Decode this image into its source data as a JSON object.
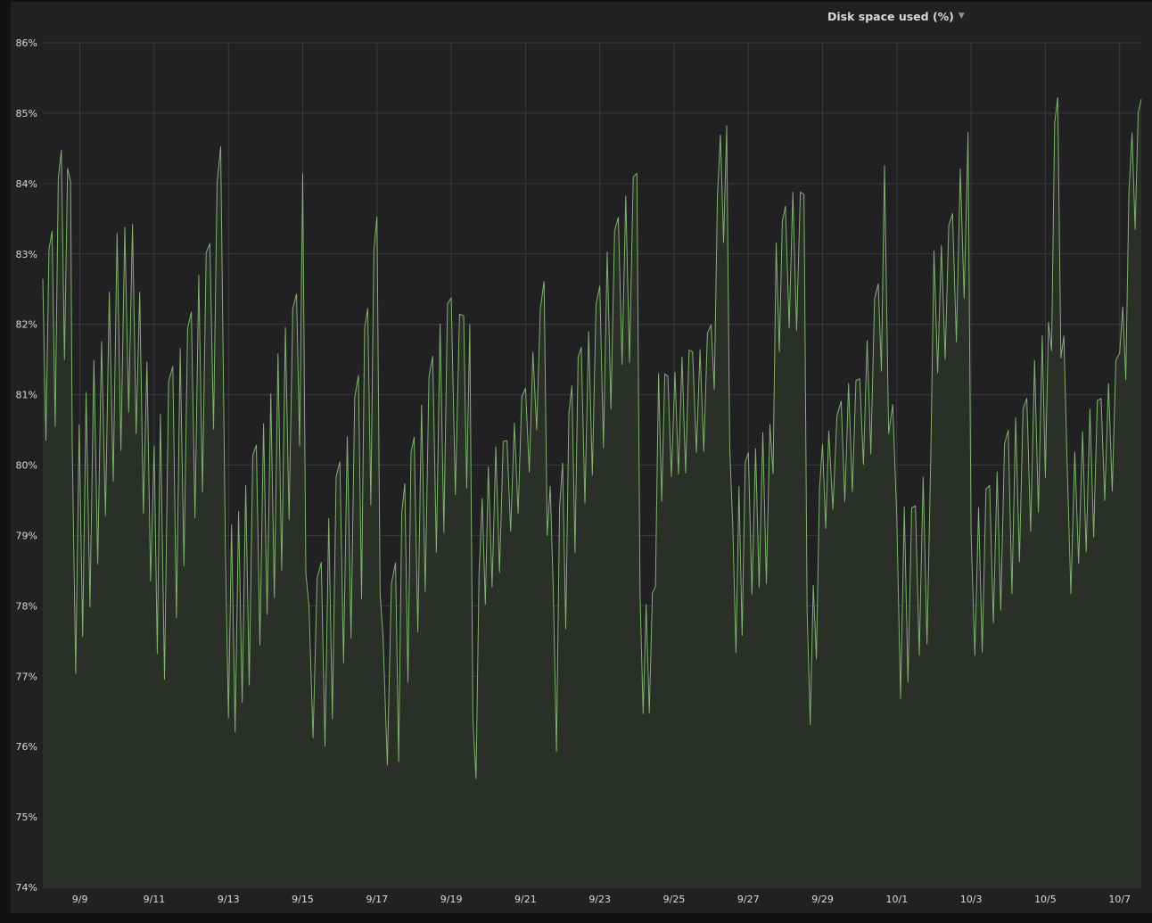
{
  "panel": {
    "title": "Disk space used (%)",
    "menu_icon": "caret-down-icon"
  },
  "colors": {
    "background": "#212124",
    "grid": "#3a3a3d",
    "series_line": "#7eb26d",
    "series_fill": "#2b3129",
    "text": "#d8d9da"
  },
  "chart_data": {
    "type": "area",
    "title": "Disk space used (%)",
    "xlabel": "",
    "ylabel": "",
    "ylim": [
      74,
      86
    ],
    "y_ticks": [
      74,
      75,
      76,
      77,
      78,
      79,
      80,
      81,
      82,
      83,
      84,
      85,
      86
    ],
    "y_tick_labels": [
      "74%",
      "75%",
      "76%",
      "77%",
      "78%",
      "79%",
      "80%",
      "81%",
      "82%",
      "83%",
      "84%",
      "85%",
      "86%"
    ],
    "x_range": [
      "2023-09-08T00:00",
      "2023-10-07T14:00"
    ],
    "x_ticks": [
      "2023-09-09",
      "2023-09-11",
      "2023-09-13",
      "2023-09-15",
      "2023-09-17",
      "2023-09-19",
      "2023-09-21",
      "2023-09-23",
      "2023-09-25",
      "2023-09-27",
      "2023-09-29",
      "2023-10-01",
      "2023-10-03",
      "2023-10-05",
      "2023-10-07"
    ],
    "x_tick_labels": [
      "9/9",
      "9/11",
      "9/13",
      "9/15",
      "9/17",
      "9/19",
      "9/21",
      "9/23",
      "9/25",
      "9/27",
      "9/29",
      "10/1",
      "10/3",
      "10/5",
      "10/7"
    ],
    "grid": true,
    "legend": "none",
    "series": [
      {
        "x": [
          "2023-09-08T00:00",
          "2023-09-08T06:00",
          "2023-09-08T12:00",
          "2023-09-08T18:00",
          "2023-09-08T19:00",
          "2023-09-09T04:00",
          "2023-09-09T14:00",
          "2023-09-10T00:00",
          "2023-09-10T10:00",
          "2023-09-11T00:00",
          "2023-09-11T04:00",
          "2023-09-11T12:00",
          "2023-09-12T00:00",
          "2023-09-12T12:00",
          "2023-09-12T19:00",
          "2023-09-12T22:00",
          "2023-09-13T02:00",
          "2023-09-13T18:00",
          "2023-09-14T08:00",
          "2023-09-14T20:00",
          "2023-09-15T00:00",
          "2023-09-15T04:00",
          "2023-09-15T12:00",
          "2023-09-16T00:00",
          "2023-09-16T12:00",
          "2023-09-16T18:00",
          "2023-09-17T00:00",
          "2023-09-17T04:00",
          "2023-09-17T12:00",
          "2023-09-17T18:00",
          "2023-09-18T00:00",
          "2023-09-18T12:00",
          "2023-09-19T00:00",
          "2023-09-19T08:00",
          "2023-09-19T12:00",
          "2023-09-19T14:00",
          "2023-09-19T20:00",
          "2023-09-20T00:00",
          "2023-09-20T12:00",
          "2023-09-21T00:00",
          "2023-09-21T12:00",
          "2023-09-21T18:00",
          "2023-09-22T00:00",
          "2023-09-22T06:00",
          "2023-09-22T12:00",
          "2023-09-23T00:00",
          "2023-09-23T12:00",
          "2023-09-24T00:00",
          "2023-09-24T02:00",
          "2023-09-24T06:00",
          "2023-09-24T12:00",
          "2023-09-24T14:00",
          "2023-09-24T20:00",
          "2023-09-25T12:00",
          "2023-09-26T00:00",
          "2023-09-26T06:00",
          "2023-09-26T10:00",
          "2023-09-26T14:00",
          "2023-09-26T18:00",
          "2023-09-27T00:00",
          "2023-09-27T14:00",
          "2023-09-27T18:00",
          "2023-09-28T00:00",
          "2023-09-28T12:00",
          "2023-09-28T14:00",
          "2023-09-28T18:00",
          "2023-09-29T00:00",
          "2023-09-29T04:00",
          "2023-09-29T12:00",
          "2023-09-30T00:00",
          "2023-09-30T12:00",
          "2023-09-30T16:00",
          "2023-10-01T00:00",
          "2023-10-01T12:00",
          "2023-10-01T22:00",
          "2023-10-02T00:00",
          "2023-10-02T12:00",
          "2023-10-02T22:00",
          "2023-10-03T00:00",
          "2023-10-03T12:00",
          "2023-10-04T00:00",
          "2023-10-04T12:00",
          "2023-10-04T22:00",
          "2023-10-05T02:00",
          "2023-10-05T06:00",
          "2023-10-05T08:00",
          "2023-10-05T14:00",
          "2023-10-06T00:00",
          "2023-10-06T12:00",
          "2023-10-07T00:00",
          "2023-10-07T02:00",
          "2023-10-07T08:00",
          "2023-10-07T14:00"
        ],
        "high": [
          82.7,
          83.5,
          84.5,
          84.1,
          80.4,
          81.1,
          81.9,
          83.3,
          83.6,
          80.4,
          80.9,
          81.4,
          82.3,
          83.3,
          84.6,
          78.8,
          79.2,
          80.3,
          81.6,
          82.6,
          84.2,
          78.0,
          78.8,
          80.1,
          81.3,
          82.3,
          83.7,
          77.6,
          78.7,
          79.9,
          80.4,
          81.7,
          82.5,
          82.2,
          82.0,
          76.4,
          79.7,
          80.1,
          80.5,
          81.1,
          82.7,
          78.2,
          80.2,
          81.2,
          81.7,
          82.6,
          83.7,
          84.2,
          78.3,
          78.2,
          78.3,
          81.3,
          81.4,
          81.7,
          82.0,
          84.8,
          85.0,
          79.2,
          79.7,
          80.3,
          80.6,
          83.3,
          83.8,
          84.0,
          78.1,
          78.4,
          80.3,
          80.6,
          81.0,
          81.4,
          82.6,
          84.4,
          79.3,
          79.6,
          80.2,
          83.1,
          83.6,
          84.9,
          79.2,
          79.8,
          80.5,
          81.1,
          81.9,
          82.2,
          85.0,
          85.3,
          80.1,
          80.6,
          81.1,
          81.6,
          82.3,
          84.9,
          85.2
        ],
        "low": [
          80.3,
          80.1,
          81.0,
          82.5,
          76.6,
          77.7,
          78.8,
          80.0,
          80.8,
          77.8,
          76.5,
          77.5,
          79.0,
          80.0,
          81.0,
          76.9,
          75.9,
          77.2,
          78.2,
          79.7,
          80.6,
          76.3,
          75.6,
          76.9,
          77.7,
          78.9,
          80.1,
          76.0,
          75.2,
          76.5,
          77.4,
          78.5,
          79.4,
          79.4,
          79.9,
          74.4,
          77.6,
          78.1,
          78.7,
          79.6,
          80.8,
          75.3,
          77.0,
          78.5,
          79.2,
          80.0,
          81.2,
          81.6,
          76.3,
          76.3,
          76.4,
          79.4,
          79.6,
          80.0,
          80.1,
          83.0,
          83.0,
          77.2,
          77.4,
          77.9,
          78.4,
          81.2,
          81.9,
          81.9,
          76.0,
          76.3,
          79.0,
          79.1,
          79.4,
          79.7,
          80.4,
          82.1,
          76.6,
          77.0,
          77.6,
          81.1,
          81.5,
          82.5,
          77.1,
          77.5,
          78.0,
          78.8,
          79.5,
          79.9,
          83.0,
          83.3,
          77.9,
          78.6,
          79.2,
          79.8,
          80.1,
          83.1,
          83.4
        ]
      }
    ]
  }
}
